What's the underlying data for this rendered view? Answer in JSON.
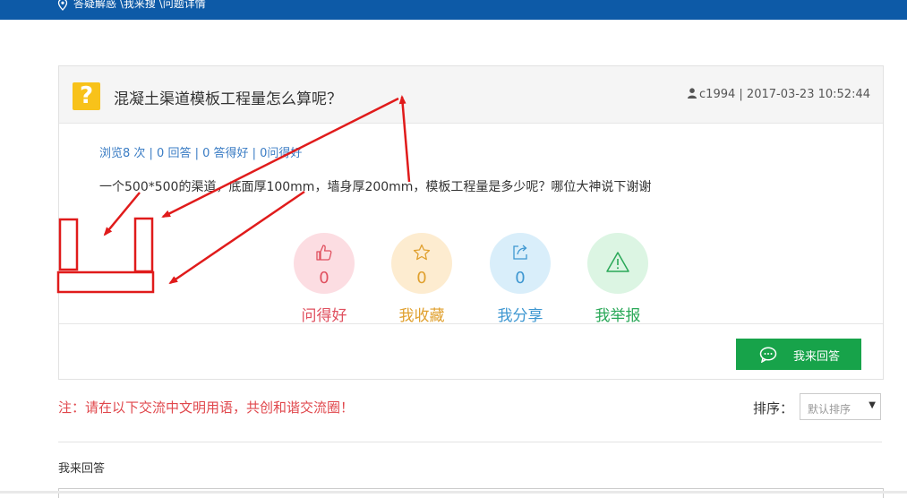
{
  "breadcrumb": "答疑解惑 \\我来搜 \\问题详情",
  "question": {
    "title": "混凝土渠道模板工程量怎么算呢？",
    "user": "c1994",
    "datetime": "| 2017-03-23 10:52:44",
    "stats": "浏览8 次 | 0 回答 | 0 答得好 | 0问得好",
    "body": "一个500*500的渠道，底面厚100mm，墙身厚200mm，模板工程量是多少呢？哪位大神说下谢谢"
  },
  "actions": [
    {
      "label": "问得好",
      "count": "0",
      "icon": "thumbs-up-icon",
      "bg": "#fcdde2",
      "color": "#e0505f"
    },
    {
      "label": "我收藏",
      "count": "0",
      "icon": "star-icon",
      "bg": "#fdecd0",
      "color": "#e0a02e"
    },
    {
      "label": "我分享",
      "count": "0",
      "icon": "share-icon",
      "bg": "#d9eefa",
      "color": "#3e97d1"
    },
    {
      "label": "我举报",
      "count": "0",
      "icon": "warning-icon",
      "bg": "#dcf5e3",
      "color": "#2aa858"
    }
  ],
  "answer_button": "我来回答",
  "notice": "注：请在以下交流中文明用语，共创和谐交流圈！",
  "sort": {
    "label": "排序：",
    "value": "默认排序"
  },
  "my_answer_title": "我来回答",
  "colors": {
    "topbar": "#0d5aa7",
    "answer_button": "#17a34a",
    "annotation": "#e01b1b"
  }
}
